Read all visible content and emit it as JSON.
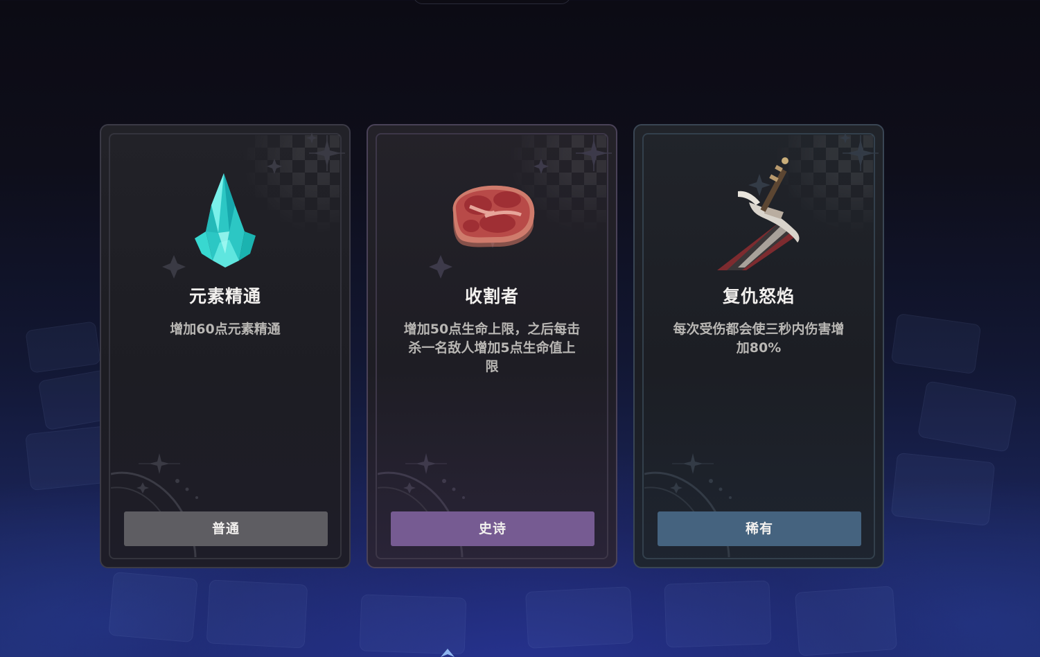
{
  "cards": [
    {
      "title": "元素精通",
      "description": "增加60点元素精通",
      "rarity_label": "普通",
      "rarity_color": "#5e5d62",
      "icon": "cyan-crystal-icon"
    },
    {
      "title": "收割者",
      "description": "增加50点生命上限，之后每击杀一名敌人增加5点生命值上限",
      "rarity_label": "史诗",
      "rarity_color": "#765b92",
      "icon": "raw-meat-icon"
    },
    {
      "title": "复仇怒焰",
      "description": "每次受伤都会使三秒内伤害增加80%",
      "rarity_label": "稀有",
      "rarity_color": "#45637f",
      "icon": "greatsword-icon"
    }
  ]
}
